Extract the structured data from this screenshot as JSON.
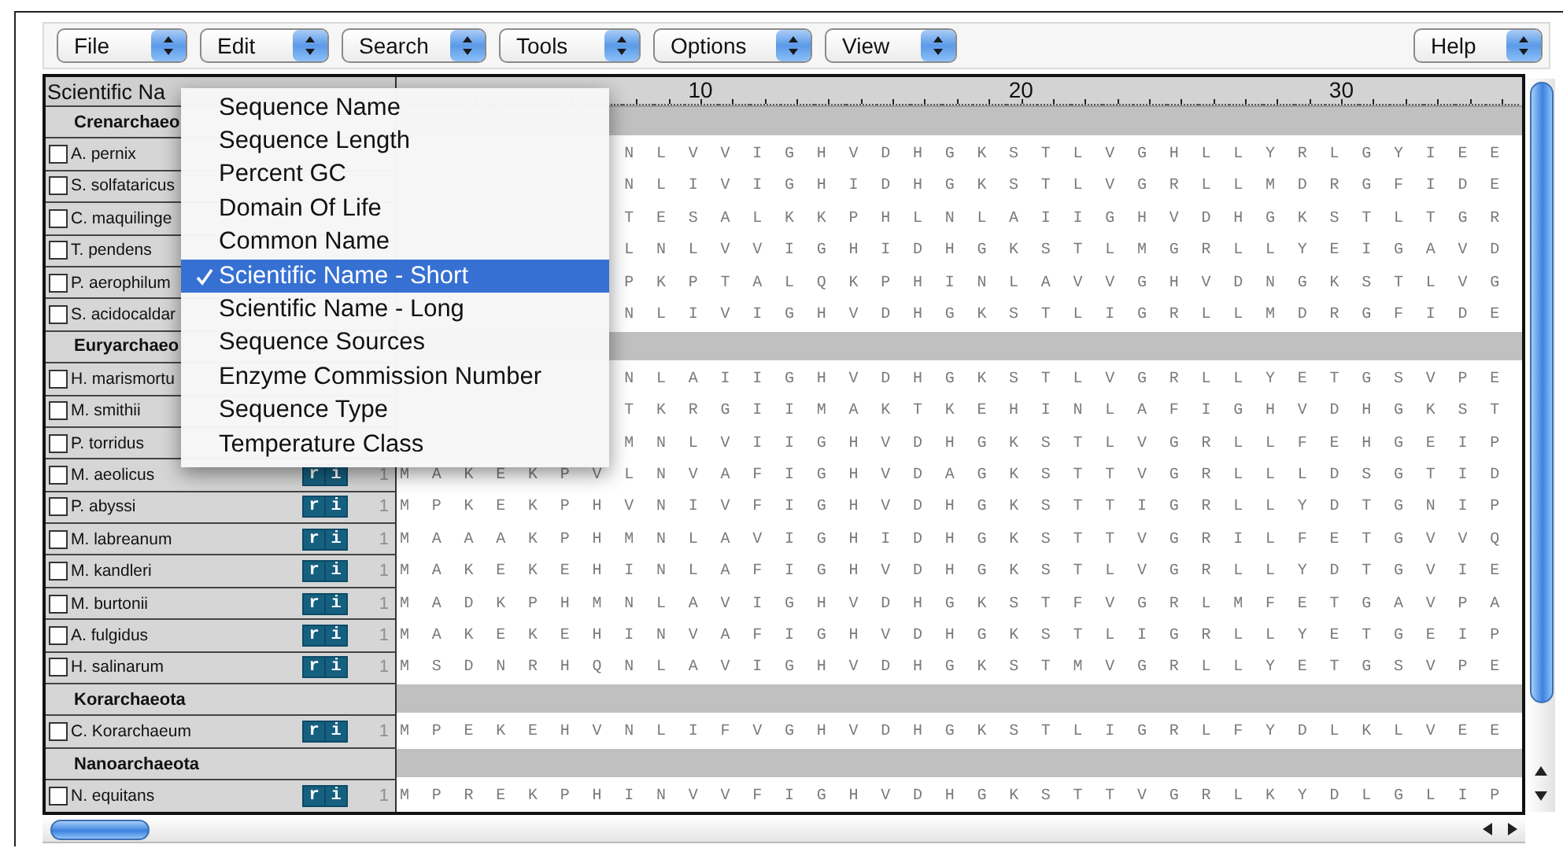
{
  "toolbar": {
    "left": [
      {
        "label": "File"
      },
      {
        "label": "Edit"
      },
      {
        "label": "Search"
      },
      {
        "label": "Tools"
      },
      {
        "label": "Options"
      },
      {
        "label": "View"
      }
    ],
    "right": [
      {
        "label": "Help"
      }
    ]
  },
  "table": {
    "header": "Scientific Na",
    "ruler": [
      "10",
      "20",
      "30"
    ],
    "groups": [
      {
        "name": "Crenarchaeo",
        "rows": [
          {
            "name": "A. pernix",
            "checked": false,
            "residues": "NLVVIGHVDHGKSTLVGHLLYRLGYIEE"
          },
          {
            "name": "S. solfataricus",
            "checked": false,
            "residues": "NLIVIGHIDHGKSTLVGRLLMDRGFIDE"
          },
          {
            "name": "C. maquilinge",
            "checked": false,
            "residues": "TESALKKPHLNLAIIGHVDHGKSTLTGR"
          },
          {
            "name": "T. pendens",
            "checked": false,
            "residues": "LNLVVIGHIDHGKSTLMGRLLYEIGAVD"
          },
          {
            "name": "P. aerophilum",
            "checked": false,
            "residues": "PKPTALQKPHINLAVVGHVDNGKSTLVG"
          },
          {
            "name": "S. acidocaldar",
            "checked": false,
            "residues": "NLIVIGHVDHGKSTLIGRLLMDRGFIDE"
          }
        ]
      },
      {
        "name": "Euryarchaeo",
        "rows": [
          {
            "name": "H. marismortu",
            "checked": false,
            "residues": "NLAIIGHVDHGKSTLVGRLLYETGSVPE"
          },
          {
            "name": "M. smithii",
            "checked": false,
            "residues": "TKRGIIMAKTKEHINLAFIGHVDHGKST"
          },
          {
            "name": "P. torridus",
            "checked": false,
            "residues": "MNLVIIGHVDHGKSTLVGRLLFEHGEIP"
          },
          {
            "name": "M. aeolicus",
            "checked": false,
            "badge": [
              "r",
              "i"
            ],
            "start": "1",
            "residues": "MAKEKPVLNVAFIGHVDAGKSTTVGRLLLDSGTID"
          },
          {
            "name": "P. abyssi",
            "checked": false,
            "badge": [
              "r",
              "i"
            ],
            "start": "1",
            "residues": "MPKEKPHVNIVFIGHVDHGKSTTIGRLLYDTGNIP"
          },
          {
            "name": "M. labreanum",
            "checked": false,
            "badge": [
              "r",
              "i"
            ],
            "start": "1",
            "residues": "MAAAKPHMNLAVIGHIDHGKSTTVGRILFETGVVQ"
          },
          {
            "name": "M. kandleri",
            "checked": false,
            "badge": [
              "r",
              "i"
            ],
            "start": "1",
            "residues": "MAKEKEHINLAFIGHVDHGKSTLVGRLLYDTGVIE"
          },
          {
            "name": "M. burtonii",
            "checked": false,
            "badge": [
              "r",
              "i"
            ],
            "start": "1",
            "residues": "MADKPHMNLAVIGHVDHGKSTFVGRLMFETGAVPA"
          },
          {
            "name": "A. fulgidus",
            "checked": false,
            "badge": [
              "r",
              "i"
            ],
            "start": "1",
            "residues": "MAKEKEHINVAFIGHVDHGKSTLIGRLLYETGEIP"
          },
          {
            "name": "H. salinarum",
            "checked": false,
            "badge": [
              "r",
              "i"
            ],
            "start": "1",
            "residues": "MSDNRHQNLAVIGHVDHGKSTMVGRLLYETGSVPE"
          }
        ]
      },
      {
        "name": "Korarchaeota",
        "rows": [
          {
            "name": "C. Korarchaeum",
            "checked": false,
            "badge": [
              "r",
              "i"
            ],
            "start": "1",
            "residues": "MPEKEHVNLIFVGHVDHGKSTLIGRLFYDLKLVEE"
          }
        ]
      },
      {
        "name": "Nanoarchaeota",
        "rows": [
          {
            "name": "N. equitans",
            "checked": false,
            "badge": [
              "r",
              "i"
            ],
            "start": "1",
            "residues": "MPREKPHINVVFIGHVDHGKSTTVGRLKYDLGLIP"
          }
        ]
      }
    ]
  },
  "menu": {
    "items": [
      {
        "label": "Sequence Name",
        "selected": false
      },
      {
        "label": "Sequence Length",
        "selected": false
      },
      {
        "label": "Percent GC",
        "selected": false
      },
      {
        "label": "Domain Of Life",
        "selected": false
      },
      {
        "label": "Common Name",
        "selected": false
      },
      {
        "label": "Scientific Name - Short",
        "selected": true
      },
      {
        "label": "Scientific Name - Long",
        "selected": false
      },
      {
        "label": "Sequence Sources",
        "selected": false
      },
      {
        "label": "Enzyme Commission Number",
        "selected": false
      },
      {
        "label": "Sequence Type",
        "selected": false
      },
      {
        "label": "Temperature Class",
        "selected": false
      }
    ]
  }
}
